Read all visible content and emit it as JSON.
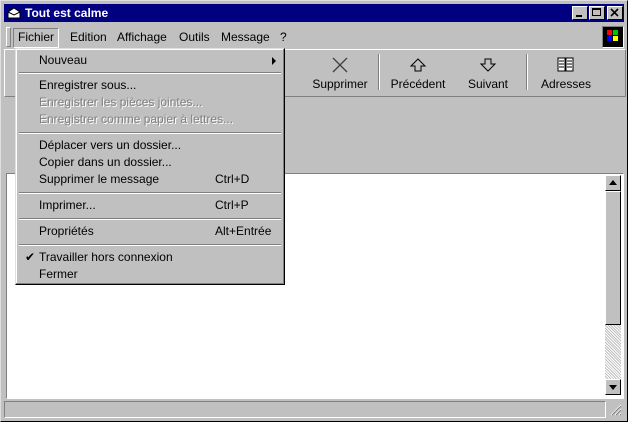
{
  "window": {
    "title": "Tout est calme"
  },
  "menubar": {
    "items": [
      {
        "label": "Fichier"
      },
      {
        "label": "Edition"
      },
      {
        "label": "Affichage"
      },
      {
        "label": "Outils"
      },
      {
        "label": "Message"
      },
      {
        "label": "?"
      }
    ]
  },
  "toolbar": {
    "buttons": [
      {
        "label": "Supprimer",
        "icon": "delete-x-icon"
      },
      {
        "label": "Précédent",
        "icon": "arrow-up-icon"
      },
      {
        "label": "Suivant",
        "icon": "arrow-down-icon"
      },
      {
        "label": "Adresses",
        "icon": "address-book-icon"
      }
    ]
  },
  "file_menu": {
    "items": [
      {
        "label": "Nouveau",
        "has_submenu": true
      },
      {
        "label": "Enregistrer sous..."
      },
      {
        "label": "Enregistrer les pièces jointes...",
        "disabled": true
      },
      {
        "label": "Enregistrer comme papier à lettres...",
        "disabled": true
      },
      {
        "label": "Déplacer vers un dossier..."
      },
      {
        "label": "Copier dans un dossier..."
      },
      {
        "label": "Supprimer le message",
        "shortcut": "Ctrl+D"
      },
      {
        "label": "Imprimer...",
        "shortcut": "Ctrl+P"
      },
      {
        "label": "Propriétés",
        "shortcut": "Alt+Entrée"
      },
      {
        "label": "Travailler hors connexion",
        "checked": true
      },
      {
        "label": "Fermer"
      }
    ]
  },
  "colors": {
    "titlebar": "#000080",
    "face": "#c0c0c0"
  }
}
